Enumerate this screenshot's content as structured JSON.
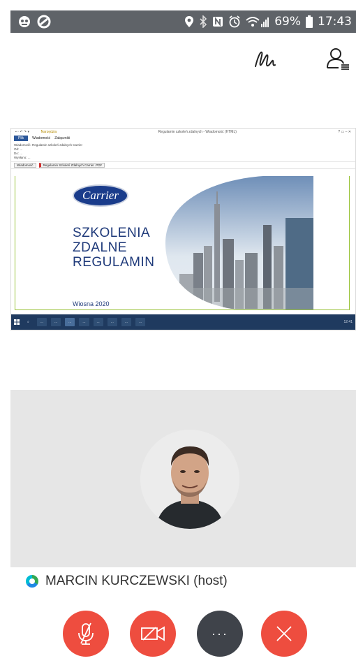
{
  "status_bar": {
    "battery_percent": "69%",
    "time": "17:43"
  },
  "top_actions": {
    "annotate_icon": "signature-icon",
    "participants_icon": "participants-list-icon"
  },
  "shared_screen": {
    "window_title": "Regulamin szkoleń zdalnych - Wiadomość (HTML)",
    "ribbon": [
      "Plik",
      "Wiadomość",
      "Załączniki"
    ],
    "ribbon_tools": "Narzędzia",
    "email_meta": [
      "Wiadomość: Regulamin szkoleń zdalnych Carrier",
      "Od: ...",
      "Do: ...",
      "Wysłano: ..."
    ],
    "attachments": [
      "Wiadomość",
      "Regulamin Szkoleń Zdalnych Carrier .PDF"
    ],
    "slide": {
      "logo_text": "Carrier",
      "title_lines": [
        "SZKOLENIA",
        "ZDALNE",
        "REGULAMIN"
      ],
      "date": "Wiosna 2020"
    },
    "taskbar_items": [
      "...",
      "...",
      "...",
      "...",
      "...",
      "...",
      "...",
      "..."
    ],
    "taskbar_time": "12:41"
  },
  "participant": {
    "name": "MARCIN KURCZEWSKI (host)"
  },
  "controls": {
    "mute_icon": "mic-off-icon",
    "video_icon": "video-off-icon",
    "more_label": "···",
    "leave_icon": "close-icon"
  },
  "colors": {
    "status_bar": "#5f6368",
    "control_red": "#ee4d3f",
    "control_dark": "#3f434a",
    "slide_blue": "#1f3a7a"
  }
}
